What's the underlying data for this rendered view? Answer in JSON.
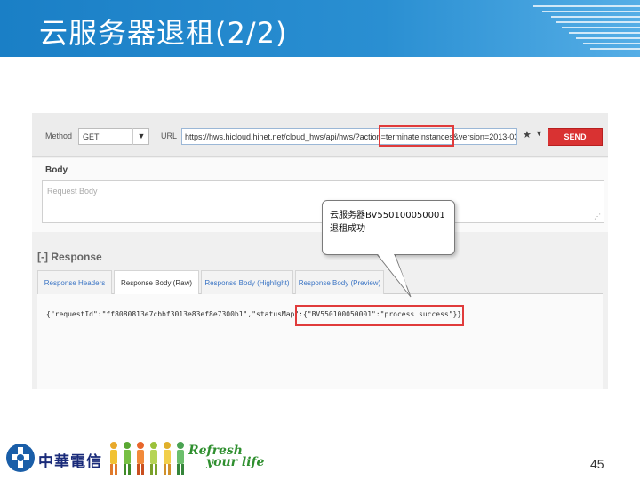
{
  "slide": {
    "title": "云服务器退租(2/2)",
    "page_number": "45"
  },
  "request": {
    "method_label": "Method",
    "method_value": "GET",
    "url_label": "URL",
    "url_value": "https://hws.hicloud.hinet.net/cloud_hws/api/hws/?action=terminateInstances&version=2013-03",
    "send_label": "SEND",
    "body_title": "Body",
    "body_placeholder": "Request Body"
  },
  "response": {
    "title": "[-] Response",
    "tabs": [
      {
        "label": "Response Headers"
      },
      {
        "label": "Response Body (Raw)"
      },
      {
        "label": "Response Body (Highlight)"
      },
      {
        "label": "Response Body (Preview)"
      }
    ],
    "body_text": "{\"requestId\":\"ff8080813e7cbbf3013e83ef8e7300b1\",\"statusMap\":{\"BV550100050001\":\"process success\"}}"
  },
  "callout": {
    "line1": "云服务器BV550100050001",
    "line2": "退租成功"
  },
  "footer": {
    "logo_text": "中華電信",
    "slogan_line1": "Refresh",
    "slogan_line2": "your life"
  },
  "colors": {
    "header_blue": "#1a7fc6",
    "highlight_red": "#e03b3b",
    "send_red": "#d93232",
    "slogan_green": "#2f8f2f"
  }
}
